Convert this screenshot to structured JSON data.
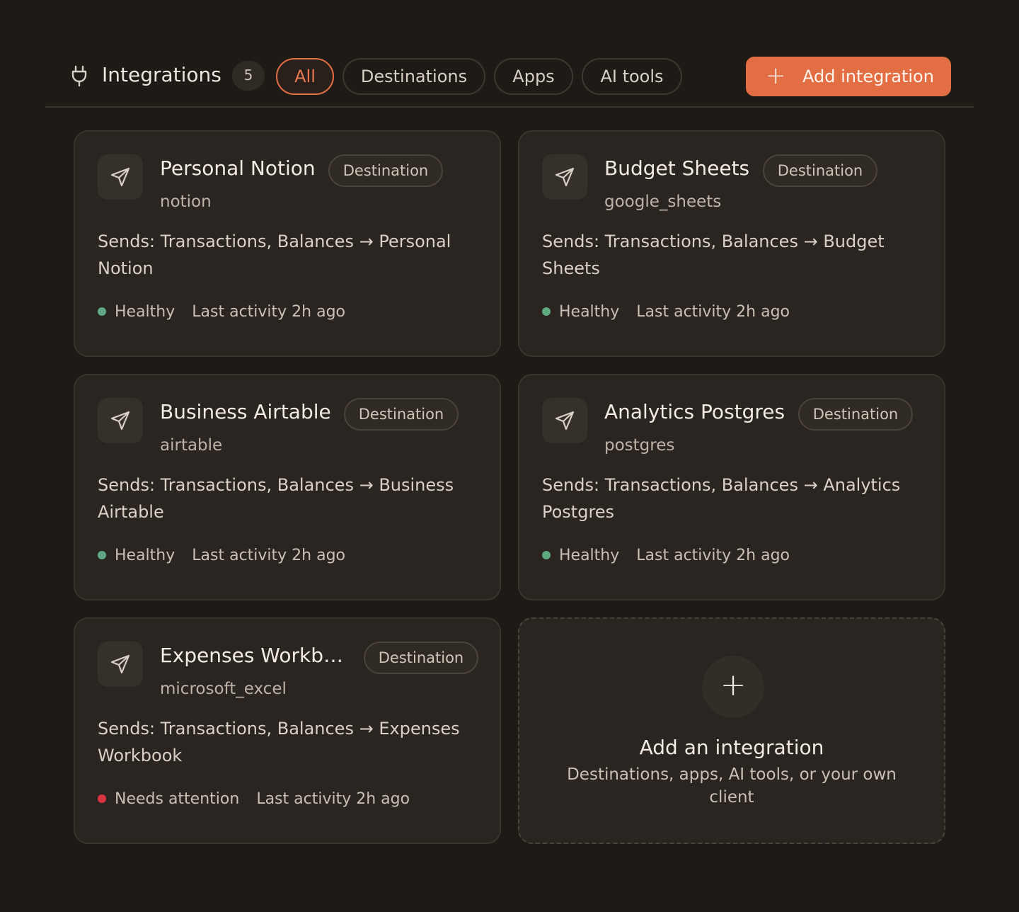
{
  "header": {
    "title": "Integrations",
    "count": "5",
    "filters": [
      "All",
      "Destinations",
      "Apps",
      "AI tools"
    ],
    "active_filter": "All",
    "add_button": "Add integration"
  },
  "status_colors": {
    "healthy": "#5fa882",
    "attention": "#d9363e"
  },
  "accent_color": "#e36e44",
  "cards": [
    {
      "name": "Personal Notion",
      "tag": "Destination",
      "provider": "notion",
      "sends": "Sends: Transactions, Balances → Personal Notion",
      "status": "Healthy",
      "status_type": "healthy",
      "activity": "Last activity 2h ago",
      "icon": "send-icon"
    },
    {
      "name": "Budget Sheets",
      "tag": "Destination",
      "provider": "google_sheets",
      "sends": "Sends: Transactions, Balances → Budget Sheets",
      "status": "Healthy",
      "status_type": "healthy",
      "activity": "Last activity 2h ago",
      "icon": "send-icon"
    },
    {
      "name": "Business Airtable",
      "tag": "Destination",
      "provider": "airtable",
      "sends": "Sends: Transactions, Balances → Business Airtable",
      "status": "Healthy",
      "status_type": "healthy",
      "activity": "Last activity 2h ago",
      "icon": "send-icon"
    },
    {
      "name": "Analytics Postgres",
      "tag": "Destination",
      "provider": "postgres",
      "sends": "Sends: Transactions, Balances → Analytics Postgres",
      "status": "Healthy",
      "status_type": "healthy",
      "activity": "Last activity 2h ago",
      "icon": "send-icon"
    },
    {
      "name": "Expenses Workb…",
      "tag": "Destination",
      "provider": "microsoft_excel",
      "sends": "Sends: Transactions, Balances → Expenses Workbook",
      "status": "Needs attention",
      "status_type": "attention",
      "activity": "Last activity 2h ago",
      "icon": "send-icon"
    }
  ],
  "add_card": {
    "title": "Add an integration",
    "subtitle": "Destinations, apps, AI tools, or your own client"
  }
}
